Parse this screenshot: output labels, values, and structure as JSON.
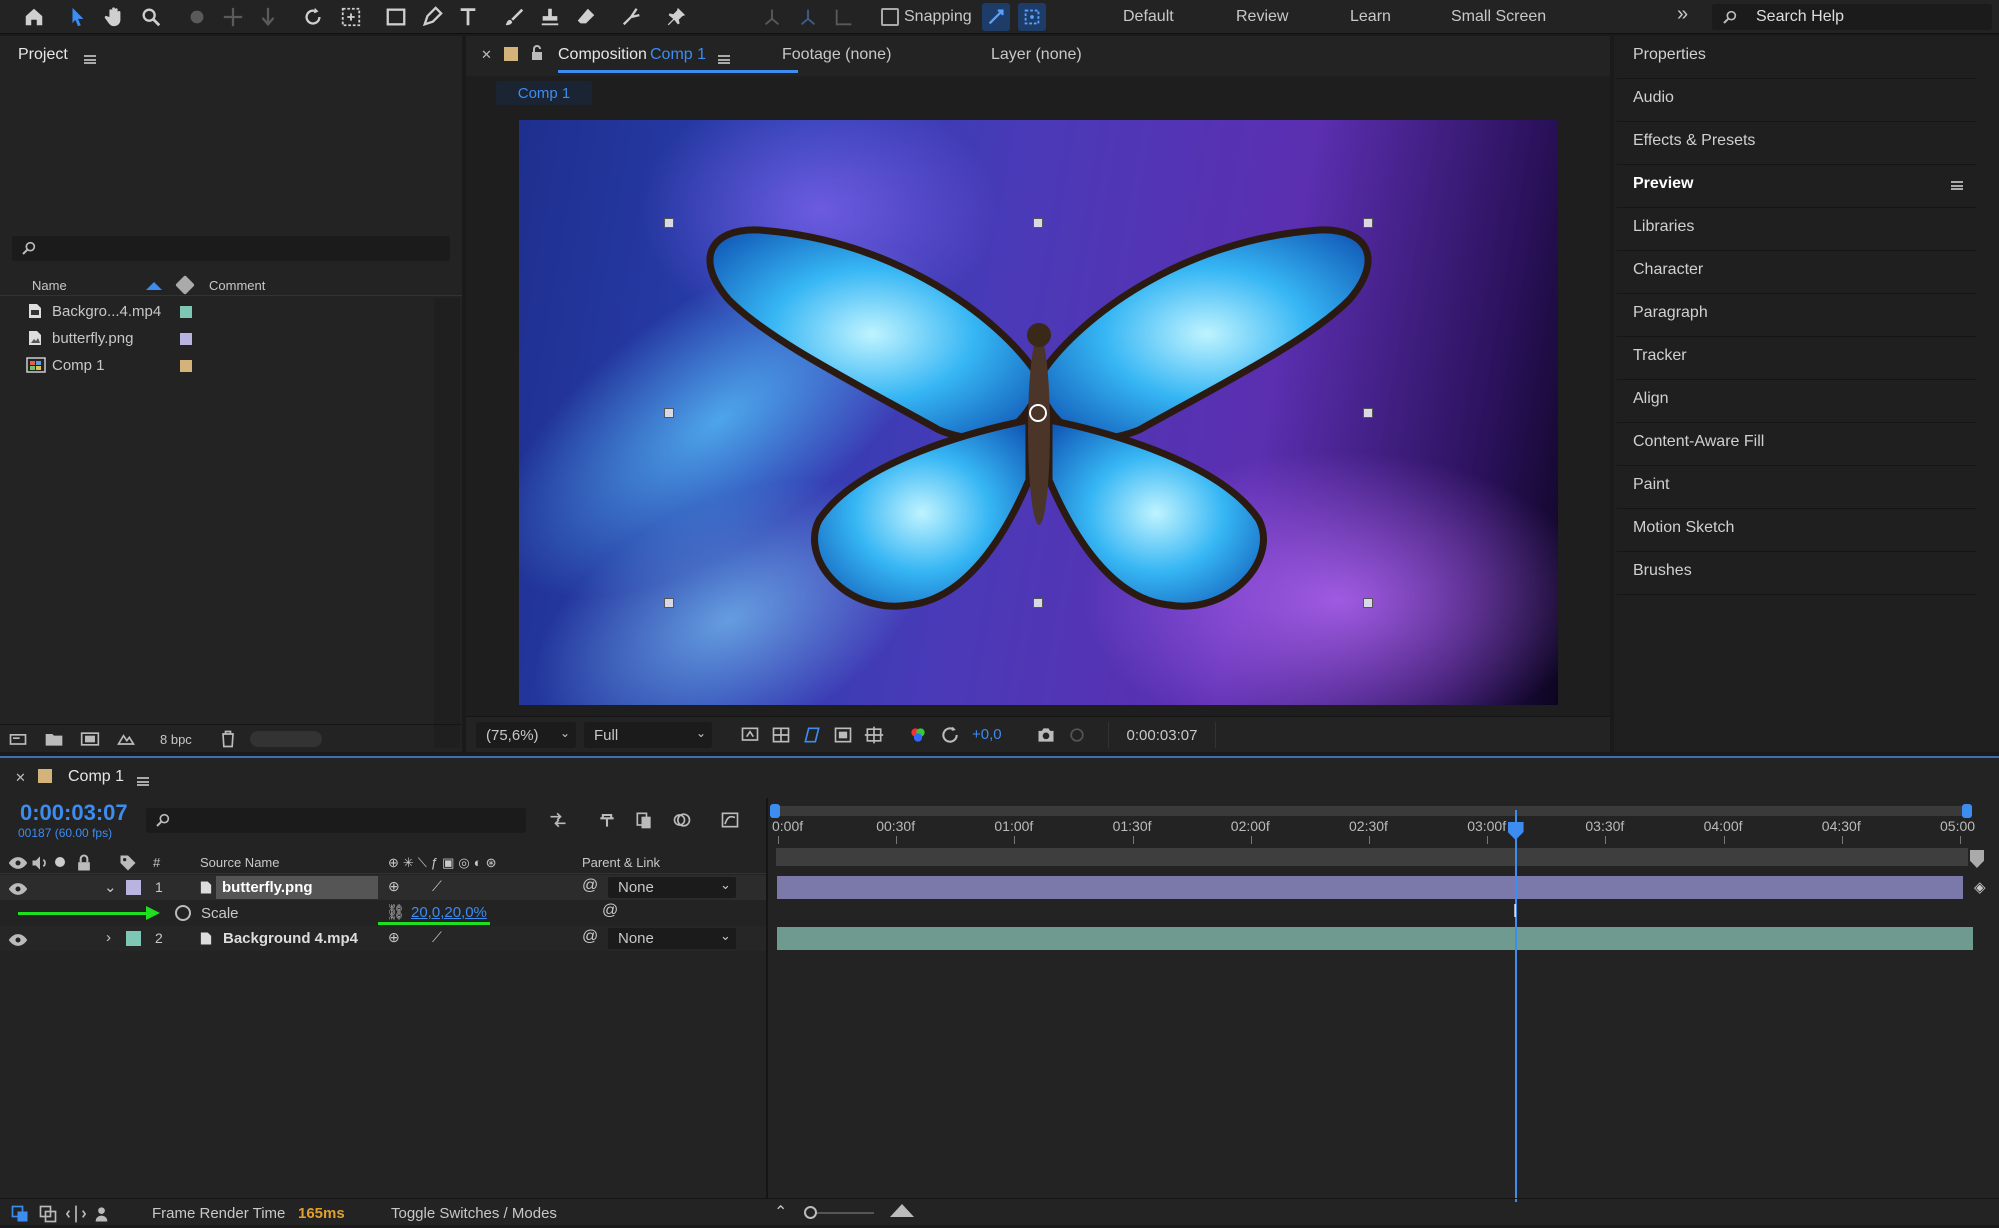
{
  "toolbar": {
    "snapping_label": "Snapping",
    "workspaces": [
      "Default",
      "Review",
      "Learn",
      "Small Screen"
    ],
    "search_placeholder": "Search Help",
    "icons": [
      "home-icon",
      "selection-arrow-icon",
      "hand-icon",
      "zoom-icon",
      "orbit-icon",
      "pan-icon",
      "dolly-icon",
      "rotate-icon",
      "pan-behind-icon",
      "rectangle-icon",
      "pen-icon",
      "type-icon",
      "brush-icon",
      "clone-stamp-icon",
      "eraser-icon",
      "roto-brush-icon",
      "puppet-pin-icon"
    ]
  },
  "project": {
    "title": "Project",
    "columns": {
      "name": "Name",
      "comment": "Comment"
    },
    "items": [
      {
        "name": "Backgro...4.mp4",
        "color": "#7fc7b5",
        "icon": "video-file-icon"
      },
      {
        "name": "butterfly.png",
        "color": "#b7b4e0",
        "icon": "image-file-icon"
      },
      {
        "name": "Comp 1",
        "color": "#d4b37a",
        "icon": "composition-icon"
      }
    ],
    "bpc": "8 bpc"
  },
  "viewer": {
    "tabs": {
      "comp_prefix": "Composition",
      "comp_name": "Comp 1",
      "footage": "Footage (none)",
      "layer": "Layer (none)"
    },
    "breadcrumb": "Comp 1",
    "zoom": "(75,6%)",
    "resolution": "Full",
    "exposure": "+0,0",
    "timecode": "0:00:03:07"
  },
  "right_panels": [
    "Properties",
    "Audio",
    "Effects & Presets",
    "Preview",
    "Libraries",
    "Character",
    "Paragraph",
    "Tracker",
    "Align",
    "Content-Aware Fill",
    "Paint",
    "Motion Sketch",
    "Brushes"
  ],
  "timeline": {
    "comp_name": "Comp 1",
    "timecode": "0:00:03:07",
    "frames": "00187 (60.00 fps)",
    "headers": {
      "num": "#",
      "source": "Source Name",
      "parent": "Parent & Link"
    },
    "ruler": [
      "0:00f",
      "00:30f",
      "01:00f",
      "01:30f",
      "02:00f",
      "02:30f",
      "03:00f",
      "03:30f",
      "04:00f",
      "04:30f",
      "05:00"
    ],
    "playhead_seconds": 3.12,
    "duration_seconds": 5,
    "layers": [
      {
        "num": "1",
        "name": "butterfly.png",
        "color": "#b7b4e0",
        "parent": "None"
      },
      {
        "num": "2",
        "name": "Background 4.mp4",
        "color": "#7fc7b5",
        "parent": "None"
      }
    ],
    "property": {
      "name": "Scale",
      "value": "20,0,20,0%"
    }
  },
  "status": {
    "frame_render_label": "Frame Render Time",
    "frame_render_value": "165ms",
    "toggle_label": "Toggle Switches / Modes"
  },
  "colors": {
    "accent": "#3d8cf0",
    "green": "#1ee01e",
    "timecode_blue": "#3d8cf0"
  }
}
